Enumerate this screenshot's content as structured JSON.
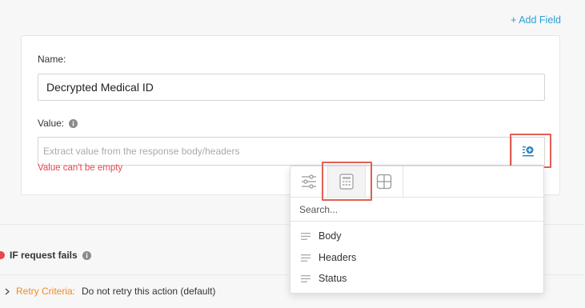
{
  "header": {
    "add_field_label": "+ Add Field"
  },
  "form": {
    "name_label": "Name:",
    "name_value": "Decrypted Medical ID",
    "value_label": "Value:",
    "value_placeholder": "Extract value from the response body/headers",
    "value_error": "Value can't be empty"
  },
  "failure": {
    "title": "IF request fails",
    "retry_key": "Retry Criteria:",
    "retry_value": "Do not retry this action (default)"
  },
  "dropdown": {
    "tabs": [
      "filters-icon",
      "calculator-icon",
      "grid-icon"
    ],
    "selected_tab": "calculator-icon",
    "search_placeholder": "Search...",
    "options": [
      {
        "label": "Body"
      },
      {
        "label": "Headers"
      },
      {
        "label": "Status"
      }
    ]
  },
  "colors": {
    "accent": "#2a9fd6",
    "error": "#e5484d",
    "highlight": "#e06055",
    "retry_key": "#f08a24"
  }
}
